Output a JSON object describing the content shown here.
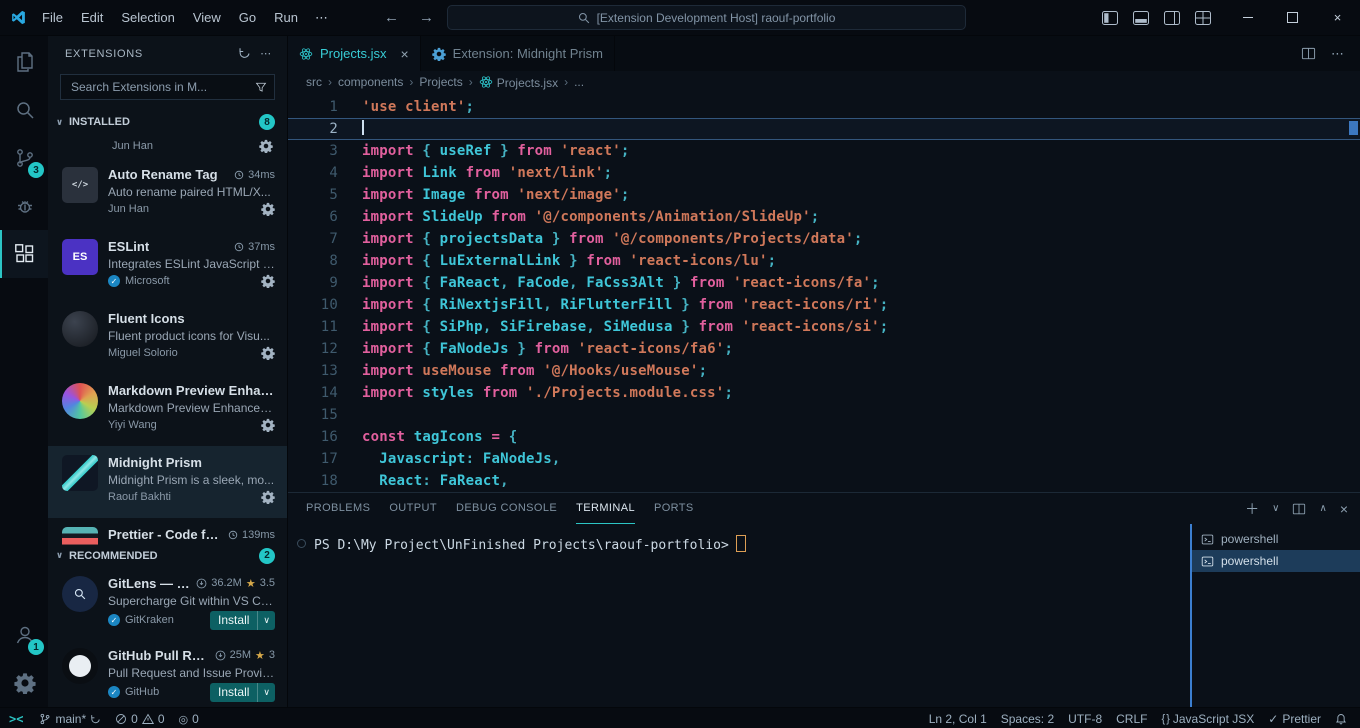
{
  "title_bar": {
    "menus": [
      "File",
      "Edit",
      "Selection",
      "View",
      "Go",
      "Run"
    ],
    "more_label": "⋯",
    "back_label": "←",
    "forward_label": "→",
    "search_text": "[Extension Development Host] raouf-portfolio"
  },
  "activity_bar": {
    "scm_badge": "3",
    "accounts_badge": "1"
  },
  "sidebar": {
    "title": "EXTENSIONS",
    "search_value": "Search Extensions in M...",
    "installed": {
      "label": "INSTALLED",
      "badge": "8"
    },
    "recommended": {
      "label": "RECOMMENDED",
      "badge": "2"
    },
    "partial_author": "Jun Han",
    "installed_items": [
      {
        "icon": "auto-rename-tag",
        "name": "Auto Rename Tag",
        "meta": "34ms",
        "desc": "Auto rename paired HTML/X...",
        "author": "Jun Han"
      },
      {
        "icon": "eslint",
        "name": "ESLint",
        "meta": "37ms",
        "desc": "Integrates ESLint JavaScript i...",
        "author": "Microsoft",
        "verified": true
      },
      {
        "icon": "fluent-icons",
        "name": "Fluent Icons",
        "desc": "Fluent product icons for Visu...",
        "author": "Miguel Solorio"
      },
      {
        "icon": "markdown-preview-enhanced",
        "name": "Markdown Preview Enhanced",
        "desc": "Markdown Preview Enhanced...",
        "author": "Yiyi Wang"
      },
      {
        "icon": "midnight-prism",
        "name": "Midnight Prism",
        "desc": "Midnight Prism is a sleek, mo...",
        "author": "Raouf Bakhti",
        "selected": true
      },
      {
        "icon": "prettier",
        "name": "Prettier - Code for...",
        "meta": "139ms",
        "partial": true
      }
    ],
    "recommended_items": [
      {
        "icon": "gitlens",
        "name": "GitLens — Git...",
        "downloads": "36.2M",
        "rating": "3.5",
        "desc": "Supercharge Git within VS Co...",
        "author": "GitKraken",
        "verified": true,
        "install": "Install"
      },
      {
        "icon": "github-pr",
        "name": "GitHub Pull Req...",
        "downloads": "25M",
        "rating": "3",
        "desc": "Pull Request and Issue Provid...",
        "author": "GitHub",
        "verified": true,
        "install": "Install"
      }
    ]
  },
  "editor": {
    "tabs": [
      {
        "label": "Projects.jsx",
        "icon": "react",
        "active": true,
        "closable": true
      },
      {
        "label": "Extension: Midnight Prism",
        "icon": "extension",
        "active": false
      }
    ],
    "breadcrumbs": [
      {
        "label": "src"
      },
      {
        "label": "components"
      },
      {
        "label": "Projects"
      },
      {
        "label": "Projects.jsx",
        "icon": "react"
      },
      {
        "label": "..."
      }
    ],
    "lines": [
      {
        "n": "1",
        "seg": [
          [
            "s",
            "'use client'"
          ],
          [
            "p",
            ";"
          ]
        ]
      },
      {
        "n": "2",
        "seg": [],
        "current": true
      },
      {
        "n": "3",
        "seg": [
          [
            "k",
            "import "
          ],
          [
            "p",
            "{ "
          ],
          [
            "i",
            "useRef"
          ],
          [
            "p",
            " } "
          ],
          [
            "k",
            "from "
          ],
          [
            "s",
            "'react'"
          ],
          [
            "p",
            ";"
          ]
        ]
      },
      {
        "n": "4",
        "seg": [
          [
            "k",
            "import "
          ],
          [
            "i",
            "Link "
          ],
          [
            "k",
            "from "
          ],
          [
            "s",
            "'next/link'"
          ],
          [
            "p",
            ";"
          ]
        ]
      },
      {
        "n": "5",
        "seg": [
          [
            "k",
            "import "
          ],
          [
            "i",
            "Image "
          ],
          [
            "k",
            "from "
          ],
          [
            "s",
            "'next/image'"
          ],
          [
            "p",
            ";"
          ]
        ]
      },
      {
        "n": "6",
        "seg": [
          [
            "k",
            "import "
          ],
          [
            "i",
            "SlideUp "
          ],
          [
            "k",
            "from "
          ],
          [
            "s",
            "'@/components/Animation/SlideUp'"
          ],
          [
            "p",
            ";"
          ]
        ]
      },
      {
        "n": "7",
        "seg": [
          [
            "k",
            "import "
          ],
          [
            "p",
            "{ "
          ],
          [
            "i",
            "projectsData"
          ],
          [
            "p",
            " } "
          ],
          [
            "k",
            "from "
          ],
          [
            "s",
            "'@/components/Projects/data'"
          ],
          [
            "p",
            ";"
          ]
        ]
      },
      {
        "n": "8",
        "seg": [
          [
            "k",
            "import "
          ],
          [
            "p",
            "{ "
          ],
          [
            "i",
            "LuExternalLink"
          ],
          [
            "p",
            " } "
          ],
          [
            "k",
            "from "
          ],
          [
            "s",
            "'react-icons/lu'"
          ],
          [
            "p",
            ";"
          ]
        ]
      },
      {
        "n": "9",
        "seg": [
          [
            "k",
            "import "
          ],
          [
            "p",
            "{ "
          ],
          [
            "i",
            "FaReact"
          ],
          [
            "p",
            ", "
          ],
          [
            "i",
            "FaCode"
          ],
          [
            "p",
            ", "
          ],
          [
            "i",
            "FaCss3Alt"
          ],
          [
            "p",
            " } "
          ],
          [
            "k",
            "from "
          ],
          [
            "s",
            "'react-icons/fa'"
          ],
          [
            "p",
            ";"
          ]
        ]
      },
      {
        "n": "10",
        "seg": [
          [
            "k",
            "import "
          ],
          [
            "p",
            "{ "
          ],
          [
            "i",
            "RiNextjsFill"
          ],
          [
            "p",
            ", "
          ],
          [
            "i",
            "RiFlutterFill"
          ],
          [
            "p",
            " } "
          ],
          [
            "k",
            "from "
          ],
          [
            "s",
            "'react-icons/ri'"
          ],
          [
            "p",
            ";"
          ]
        ]
      },
      {
        "n": "11",
        "seg": [
          [
            "k",
            "import "
          ],
          [
            "p",
            "{ "
          ],
          [
            "i",
            "SiPhp"
          ],
          [
            "p",
            ", "
          ],
          [
            "i",
            "SiFirebase"
          ],
          [
            "p",
            ", "
          ],
          [
            "i",
            "SiMedusa"
          ],
          [
            "p",
            " } "
          ],
          [
            "k",
            "from "
          ],
          [
            "s",
            "'react-icons/si'"
          ],
          [
            "p",
            ";"
          ]
        ]
      },
      {
        "n": "12",
        "seg": [
          [
            "k",
            "import "
          ],
          [
            "p",
            "{ "
          ],
          [
            "i",
            "FaNodeJs"
          ],
          [
            "p",
            " } "
          ],
          [
            "k",
            "from "
          ],
          [
            "s",
            "'react-icons/fa6'"
          ],
          [
            "p",
            ";"
          ]
        ]
      },
      {
        "n": "13",
        "seg": [
          [
            "k",
            "import "
          ],
          [
            "o",
            "useMouse "
          ],
          [
            "k",
            "from "
          ],
          [
            "s",
            "'@/Hooks/useMouse'"
          ],
          [
            "p",
            ";"
          ]
        ]
      },
      {
        "n": "14",
        "seg": [
          [
            "k",
            "import "
          ],
          [
            "i",
            "styles "
          ],
          [
            "k",
            "from "
          ],
          [
            "s",
            "'./Projects.module.css'"
          ],
          [
            "p",
            ";"
          ]
        ]
      },
      {
        "n": "15",
        "seg": []
      },
      {
        "n": "16",
        "seg": [
          [
            "k",
            "const "
          ],
          [
            "i",
            "tagIcons "
          ],
          [
            "k",
            "= "
          ],
          [
            "p",
            "{"
          ]
        ]
      },
      {
        "n": "17",
        "seg": [
          [
            "d",
            "  "
          ],
          [
            "i",
            "Javascript"
          ],
          [
            "p",
            ": "
          ],
          [
            "i",
            "FaNodeJs"
          ],
          [
            "p",
            ","
          ]
        ]
      },
      {
        "n": "18",
        "seg": [
          [
            "d",
            "  "
          ],
          [
            "i",
            "React"
          ],
          [
            "p",
            ": "
          ],
          [
            "i",
            "FaReact"
          ],
          [
            "p",
            ","
          ]
        ]
      }
    ]
  },
  "panel": {
    "tabs": [
      {
        "label": "PROBLEMS"
      },
      {
        "label": "OUTPUT"
      },
      {
        "label": "DEBUG CONSOLE"
      },
      {
        "label": "TERMINAL",
        "active": true
      },
      {
        "label": "PORTS"
      }
    ],
    "terminal_prompt": "PS D:\\My Project\\UnFinished Projects\\raouf-portfolio>",
    "terminal_list": [
      {
        "label": "powershell"
      },
      {
        "label": "powershell",
        "selected": true
      }
    ]
  },
  "status_bar": {
    "remote": "><",
    "branch": "main*",
    "errors": "0",
    "warnings": "0",
    "radio": "0",
    "line_col": "Ln 2, Col 1",
    "spaces": "Spaces: 2",
    "encoding": "UTF-8",
    "eol": "CRLF",
    "language": "JavaScript JSX",
    "formatter": "Prettier"
  }
}
